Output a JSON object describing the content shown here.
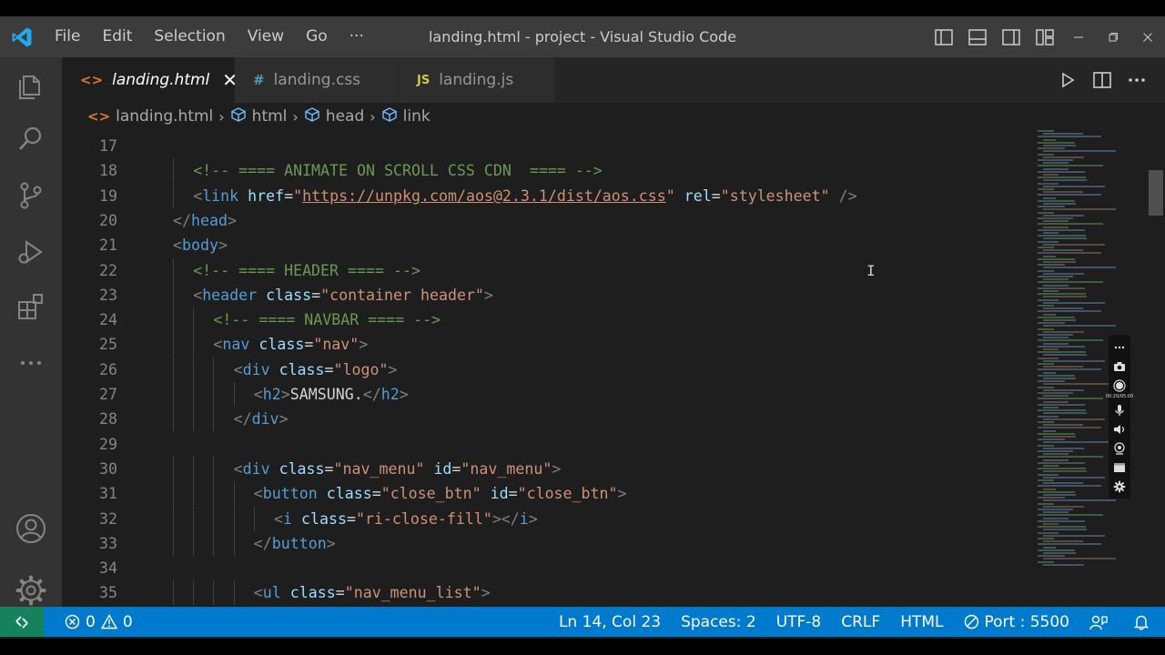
{
  "titlebar": {
    "menu": [
      "File",
      "Edit",
      "Selection",
      "View",
      "Go",
      "···"
    ],
    "title": "landing.html - project - Visual Studio Code"
  },
  "tabs": [
    {
      "icon": "<>",
      "label": "landing.html",
      "active": true,
      "close": "✕"
    },
    {
      "icon": "#",
      "label": "landing.css",
      "active": false
    },
    {
      "icon": "JS",
      "label": "landing.js",
      "active": false
    }
  ],
  "breadcrumb": [
    "landing.html",
    "html",
    "head",
    "link"
  ],
  "editor": {
    "lines": [
      {
        "n": "17",
        "indent": 0,
        "tokens": []
      },
      {
        "n": "18",
        "indent": 1,
        "tokens": [
          [
            "c-cmt",
            "<!-- ==== ANIMATE ON SCROLL CSS CDN  ==== -->"
          ]
        ]
      },
      {
        "n": "19",
        "indent": 1,
        "tokens": [
          [
            "c-br",
            "<"
          ],
          [
            "c-tag",
            "link"
          ],
          [
            "c-txt",
            " "
          ],
          [
            "c-attr",
            "href"
          ],
          [
            "c-txt",
            "="
          ],
          [
            "c-str",
            "\""
          ],
          [
            "c-url",
            "https://unpkg.com/aos@2.3.1/dist/aos.css"
          ],
          [
            "c-str",
            "\""
          ],
          [
            "c-txt",
            " "
          ],
          [
            "c-attr",
            "rel"
          ],
          [
            "c-txt",
            "="
          ],
          [
            "c-str",
            "\"stylesheet\""
          ],
          [
            "c-txt",
            " "
          ],
          [
            "c-br",
            "/>"
          ]
        ]
      },
      {
        "n": "20",
        "indent": 0,
        "tokens": [
          [
            "c-br",
            "</"
          ],
          [
            "c-tag",
            "head"
          ],
          [
            "c-br",
            ">"
          ]
        ]
      },
      {
        "n": "21",
        "indent": 0,
        "tokens": [
          [
            "c-br",
            "<"
          ],
          [
            "c-tag",
            "body"
          ],
          [
            "c-br",
            ">"
          ]
        ]
      },
      {
        "n": "22",
        "indent": 1,
        "tokens": [
          [
            "c-cmt",
            "<!-- ==== HEADER ==== -->"
          ]
        ]
      },
      {
        "n": "23",
        "indent": 1,
        "tokens": [
          [
            "c-br",
            "<"
          ],
          [
            "c-tag",
            "header"
          ],
          [
            "c-txt",
            " "
          ],
          [
            "c-attr",
            "class"
          ],
          [
            "c-txt",
            "="
          ],
          [
            "c-str",
            "\"container header\""
          ],
          [
            "c-br",
            ">"
          ]
        ]
      },
      {
        "n": "24",
        "indent": 2,
        "tokens": [
          [
            "c-cmt",
            "<!-- ==== NAVBAR ==== -->"
          ]
        ]
      },
      {
        "n": "25",
        "indent": 2,
        "tokens": [
          [
            "c-br",
            "<"
          ],
          [
            "c-tag",
            "nav"
          ],
          [
            "c-txt",
            " "
          ],
          [
            "c-attr",
            "class"
          ],
          [
            "c-txt",
            "="
          ],
          [
            "c-str",
            "\"nav\""
          ],
          [
            "c-br",
            ">"
          ]
        ]
      },
      {
        "n": "26",
        "indent": 3,
        "tokens": [
          [
            "c-br",
            "<"
          ],
          [
            "c-tag",
            "div"
          ],
          [
            "c-txt",
            " "
          ],
          [
            "c-attr",
            "class"
          ],
          [
            "c-txt",
            "="
          ],
          [
            "c-str",
            "\"logo\""
          ],
          [
            "c-br",
            ">"
          ]
        ]
      },
      {
        "n": "27",
        "indent": 4,
        "tokens": [
          [
            "c-br",
            "<"
          ],
          [
            "c-tag",
            "h2"
          ],
          [
            "c-br",
            ">"
          ],
          [
            "c-txt",
            "SAMSUNG."
          ],
          [
            "c-br",
            "</"
          ],
          [
            "c-tag",
            "h2"
          ],
          [
            "c-br",
            ">"
          ]
        ]
      },
      {
        "n": "28",
        "indent": 3,
        "tokens": [
          [
            "c-br",
            "</"
          ],
          [
            "c-tag",
            "div"
          ],
          [
            "c-br",
            ">"
          ]
        ]
      },
      {
        "n": "29",
        "indent": 0,
        "tokens": []
      },
      {
        "n": "30",
        "indent": 3,
        "tokens": [
          [
            "c-br",
            "<"
          ],
          [
            "c-tag",
            "div"
          ],
          [
            "c-txt",
            " "
          ],
          [
            "c-attr",
            "class"
          ],
          [
            "c-txt",
            "="
          ],
          [
            "c-str",
            "\"nav_menu\""
          ],
          [
            "c-txt",
            " "
          ],
          [
            "c-attr",
            "id"
          ],
          [
            "c-txt",
            "="
          ],
          [
            "c-str",
            "\"nav_menu\""
          ],
          [
            "c-br",
            ">"
          ]
        ]
      },
      {
        "n": "31",
        "indent": 4,
        "tokens": [
          [
            "c-br",
            "<"
          ],
          [
            "c-tag",
            "button"
          ],
          [
            "c-txt",
            " "
          ],
          [
            "c-attr",
            "class"
          ],
          [
            "c-txt",
            "="
          ],
          [
            "c-str",
            "\"close_btn\""
          ],
          [
            "c-txt",
            " "
          ],
          [
            "c-attr",
            "id"
          ],
          [
            "c-txt",
            "="
          ],
          [
            "c-str",
            "\"close_btn\""
          ],
          [
            "c-br",
            ">"
          ]
        ]
      },
      {
        "n": "32",
        "indent": 5,
        "tokens": [
          [
            "c-br",
            "<"
          ],
          [
            "c-tag",
            "i"
          ],
          [
            "c-txt",
            " "
          ],
          [
            "c-attr",
            "class"
          ],
          [
            "c-txt",
            "="
          ],
          [
            "c-str",
            "\"ri-close-fill\""
          ],
          [
            "c-br",
            "></"
          ],
          [
            "c-tag",
            "i"
          ],
          [
            "c-br",
            ">"
          ]
        ]
      },
      {
        "n": "33",
        "indent": 4,
        "tokens": [
          [
            "c-br",
            "</"
          ],
          [
            "c-tag",
            "button"
          ],
          [
            "c-br",
            ">"
          ]
        ]
      },
      {
        "n": "34",
        "indent": 0,
        "tokens": []
      },
      {
        "n": "35",
        "indent": 4,
        "tokens": [
          [
            "c-br",
            "<"
          ],
          [
            "c-tag",
            "ul"
          ],
          [
            "c-txt",
            " "
          ],
          [
            "c-attr",
            "class"
          ],
          [
            "c-txt",
            "="
          ],
          [
            "c-str",
            "\"nav_menu_list\""
          ],
          [
            "c-br",
            ">"
          ]
        ]
      }
    ]
  },
  "recorder": {
    "timer": "00:20/05:00"
  },
  "statusbar": {
    "errors": "0",
    "warnings": "0",
    "position": "Ln 14, Col 23",
    "spaces": "Spaces: 2",
    "encoding": "UTF-8",
    "eol": "CRLF",
    "language": "HTML",
    "port": "Port : 5500"
  },
  "colors": {
    "accent": "#007acc",
    "remote": "#16825d",
    "titlebar": "#3c3c3c",
    "activitybar": "#333333",
    "editor_bg": "#1e1e1e"
  }
}
